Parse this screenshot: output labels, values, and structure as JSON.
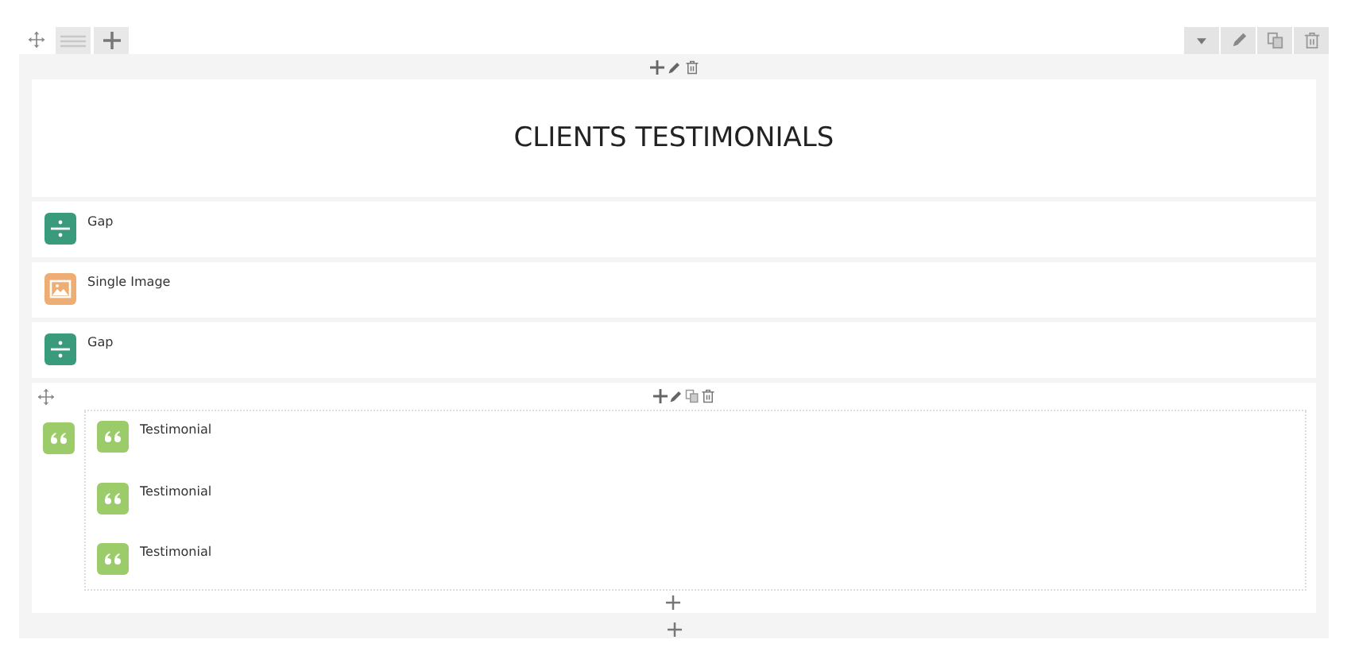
{
  "heading": {
    "text": "CLIENTS TESTIMONIALS"
  },
  "elements": [
    {
      "kind": "gap",
      "label": "Gap"
    },
    {
      "kind": "image",
      "label": "Single Image"
    },
    {
      "kind": "gap",
      "label": "Gap"
    }
  ],
  "container": {
    "kind": "testimonial",
    "children": [
      {
        "kind": "testimonial",
        "label": "Testimonial"
      },
      {
        "kind": "testimonial",
        "label": "Testimonial"
      },
      {
        "kind": "testimonial",
        "label": "Testimonial"
      }
    ]
  }
}
